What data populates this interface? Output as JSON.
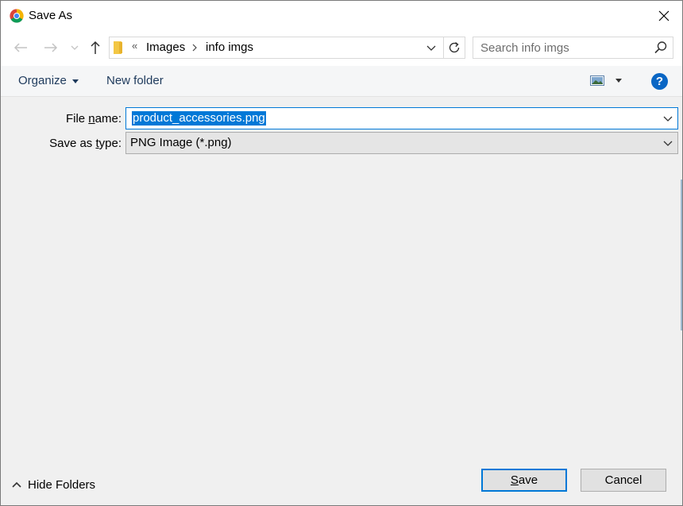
{
  "window": {
    "title": "Save As",
    "colors": {
      "accent": "#0078d7",
      "help": "#0a66c4",
      "folder": "#f3c744"
    }
  },
  "address": {
    "overflow": "«",
    "breadcrumb": [
      "Images",
      "info imgs"
    ]
  },
  "search": {
    "placeholder": "Search info imgs"
  },
  "toolbar": {
    "organize": "Organize",
    "new_folder": "New folder",
    "help": "?"
  },
  "form": {
    "filename_label_pre": "File ",
    "filename_label_key": "n",
    "filename_label_post": "ame:",
    "filename_value": "product_accessories.png",
    "type_label_pre": "Save as ",
    "type_label_key": "t",
    "type_label_post": "ype:",
    "type_value": "PNG Image (*.png)"
  },
  "footer": {
    "hide_folders": "Hide Folders",
    "save_key": "S",
    "save_rest": "ave",
    "cancel": "Cancel"
  },
  "icons": [
    "chrome-app-icon",
    "close-icon",
    "back-arrow-icon",
    "forward-arrow-icon",
    "recent-chevron-icon",
    "up-arrow-icon",
    "folder-icon",
    "breadcrumb-chevron-icon",
    "dropdown-chevron-icon",
    "refresh-icon",
    "search-icon",
    "caret-down-icon",
    "view-thumbnail-icon",
    "help-icon",
    "chevron-up-icon"
  ]
}
